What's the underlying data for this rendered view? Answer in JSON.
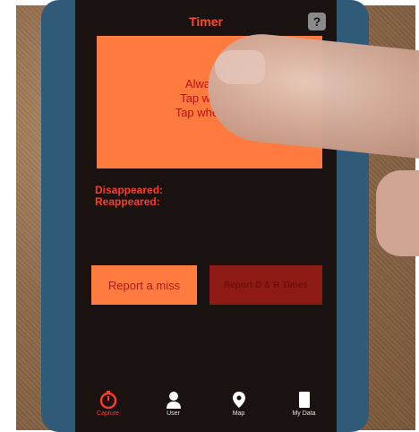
{
  "nav": {
    "title": "Timer",
    "help_label": "?"
  },
  "status_panel": {
    "line1": "Always w",
    "line2": "Tap when s",
    "line3": "Tap when sta"
  },
  "timers": {
    "disappeared_label": "Disappeared:",
    "reappeared_label": "Reappeared:"
  },
  "buttons": {
    "report_miss_label": "Report a miss",
    "report_dr_label": "Report D & R Times"
  },
  "tabs": [
    {
      "label": "Capture",
      "icon": "stopwatch-icon",
      "active": true
    },
    {
      "label": "User",
      "icon": "user-icon",
      "active": false
    },
    {
      "label": "Map",
      "icon": "map-pin-icon",
      "active": false
    },
    {
      "label": "My Data",
      "icon": "document-icon",
      "active": false
    }
  ],
  "colors": {
    "screen_bg": "#1a1111",
    "accent_red": "#ff3a2a",
    "panel_orange": "#ff7a3e",
    "disabled_button": "#8e1a16"
  }
}
